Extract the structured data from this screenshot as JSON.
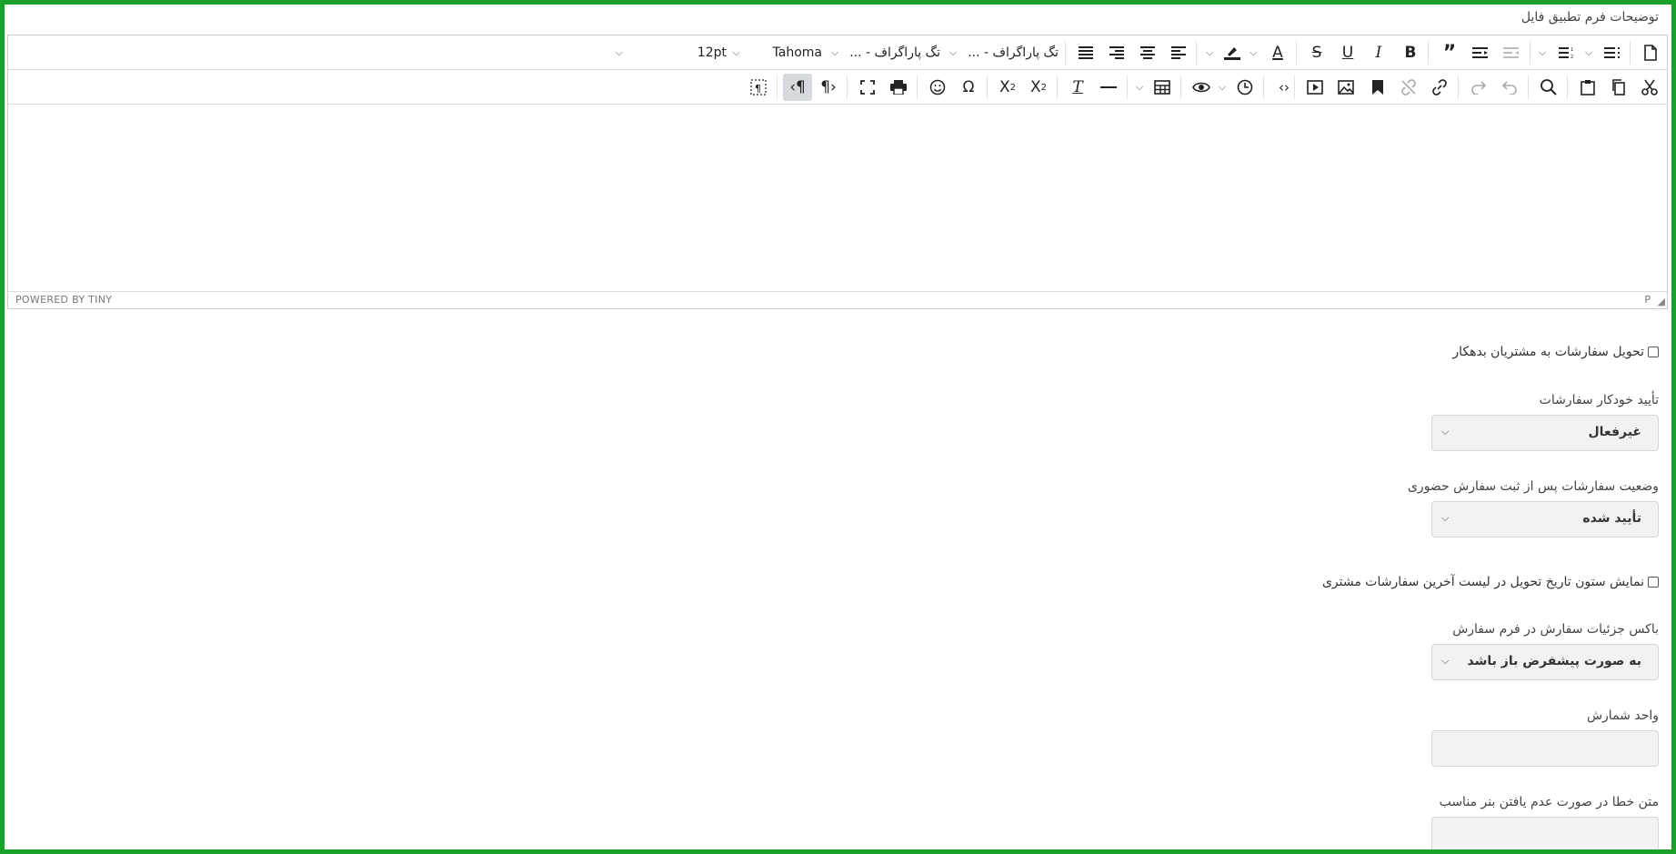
{
  "editor": {
    "label": "توضیحات فرم تطبیق فایل",
    "font_size": "12pt",
    "font_family": "Tahoma",
    "block_format_1": "تگ پاراگراف - ...",
    "block_format_2": "تگ پاراگراف - ...",
    "status_left": "POWERED BY TINY",
    "status_path": "P"
  },
  "toolbar_row1_icons": [
    "new-document",
    "bullet-list",
    "numbered-list",
    "outdent",
    "indent",
    "blockquote",
    "bold",
    "italic",
    "underline",
    "strikethrough",
    "text-color",
    "highlight-color",
    "align-left",
    "align-center",
    "align-right",
    "justify"
  ],
  "toolbar_row2_icons": [
    "cut",
    "copy",
    "paste",
    "search",
    "undo",
    "redo",
    "link",
    "unlink",
    "bookmark",
    "image",
    "media",
    "code",
    "date-time",
    "preview",
    "table",
    "horizontal-line",
    "clear-formatting",
    "subscript",
    "superscript",
    "special-character",
    "emoji",
    "print",
    "fullscreen",
    "ltr",
    "rtl",
    "visual-chars"
  ],
  "settings": {
    "deliver_debtors_label": "تحویل سفارشات به مشتریان بدهکار",
    "auto_confirm_label": "تأیید خودکار سفارشات",
    "auto_confirm_value": "غیرفعال",
    "in_person_status_label": "وضعیت سفارشات پس از ثبت سفارش حضوری",
    "in_person_status_value": "تأیید شده",
    "show_delivery_date_label": "نمایش ستون تاریخ تحویل در لیست آخرین سفارشات مشتری",
    "order_details_box_label": "باکس جزئیات سفارش در فرم سفارش",
    "order_details_box_value": "به صورت پیشفرض باز باشد",
    "count_unit_label": "واحد شمارش",
    "count_unit_value": "",
    "banner_error_label": "متن خطا در صورت عدم یافتن بنر مناسب",
    "banner_error_value": ""
  },
  "colors": {
    "frame_border": "#19a22b",
    "active_button": "#d6d9dd",
    "field_background": "#f1f2f3"
  }
}
